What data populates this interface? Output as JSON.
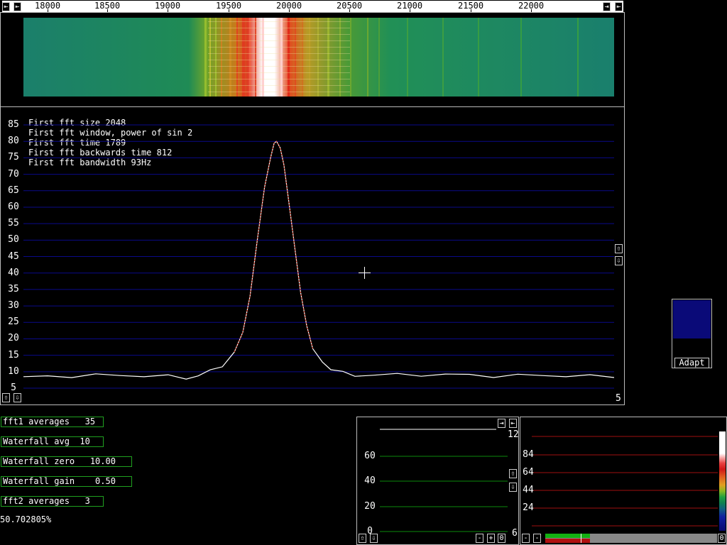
{
  "freq_axis": {
    "ticks": [
      "18000",
      "18500",
      "19000",
      "19500",
      "20000",
      "20500",
      "21000",
      "21500",
      "22000"
    ]
  },
  "spectrum": {
    "info_lines": [
      "First fft size 2048",
      "First fft window, power of sin 2",
      "First fft time 1789",
      "First fft backwards time 812",
      "First fft bandwidth 93Hz"
    ],
    "y_ticks": [
      "85",
      "80",
      "75",
      "70",
      "65",
      "60",
      "55",
      "50",
      "45",
      "40",
      "35",
      "30",
      "25",
      "20",
      "15",
      "10",
      "5"
    ],
    "bottom_right_label": "5",
    "chart_data": {
      "type": "line",
      "ylim": [
        5,
        85
      ],
      "xlim": [
        17800,
        22700
      ],
      "series": [
        {
          "x": [
            17800,
            18000,
            18200,
            18400,
            18600,
            18800,
            19000,
            19150,
            19250,
            19350,
            19450,
            19550,
            19620,
            19680,
            19740,
            19800,
            19850,
            19880,
            19900,
            19930,
            19960,
            20000,
            20050,
            20100,
            20150,
            20200,
            20280,
            20350,
            20450,
            20550,
            20700,
            20900,
            21100,
            21300,
            21500,
            21700,
            21900,
            22100,
            22300,
            22500,
            22700
          ],
          "y": [
            8.5,
            8.3,
            8.8,
            9,
            8.7,
            9,
            8.5,
            8,
            9,
            10,
            12,
            16,
            22,
            33,
            50,
            66,
            75,
            79.5,
            80,
            78,
            73,
            62,
            48,
            34,
            24,
            17,
            13,
            11,
            9.5,
            9,
            9,
            9,
            9.2,
            9,
            9,
            8.8,
            8.7,
            9,
            8.8,
            8.5,
            8.7
          ]
        }
      ]
    }
  },
  "adapt_button": "Adapt",
  "params": [
    {
      "label": "fft1 averages   35"
    },
    {
      "label": "Waterfall avg  10"
    },
    {
      "label": "Waterfall zero   10.00"
    },
    {
      "label": "Waterfall gain    0.50"
    },
    {
      "label": "fft2 averages   3"
    }
  ],
  "percent_readout": "50.702805%",
  "mid_panel": {
    "y_ticks": [
      "60",
      "40",
      "20",
      "0"
    ],
    "top_right": "12",
    "bottom_right": "6",
    "minus_btn": "-",
    "plus_btn": "+",
    "zero_btn": "0"
  },
  "right_panel": {
    "y_ticks": [
      "84",
      "64",
      "44",
      "24"
    ],
    "minus_btn": "-",
    "minus2_btn": "-",
    "zero_btn": "0"
  },
  "colors": {
    "waterfall_bg": "#1a8a5a",
    "spectrum_grid": "#0a0a8a",
    "param_border": "#1fa01f",
    "mid_grid": "#0b8a0b",
    "right_grid": "#a01010"
  }
}
